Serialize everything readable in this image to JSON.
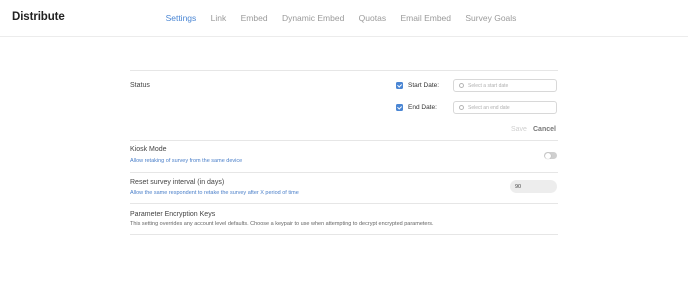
{
  "app": {
    "title": "Distribute"
  },
  "nav": {
    "tabs": [
      {
        "label": "Settings",
        "active": true
      },
      {
        "label": "Link"
      },
      {
        "label": "Embed"
      },
      {
        "label": "Dynamic Embed"
      },
      {
        "label": "Quotas"
      },
      {
        "label": "Email Embed"
      },
      {
        "label": "Survey Goals"
      }
    ]
  },
  "status": {
    "label": "Status",
    "start_date": {
      "label": "Start Date:",
      "checked": true,
      "placeholder": "Select a start date"
    },
    "end_date": {
      "label": "End Date:",
      "checked": true,
      "placeholder": "Select an end date"
    },
    "save_label": "Save",
    "cancel_label": "Cancel"
  },
  "kiosk": {
    "label": "Kiosk Mode",
    "description": "Allow retaking of survey from the same device",
    "enabled": false
  },
  "reset": {
    "label": "Reset survey interval (in days)",
    "description": "Allow the same respondent to retake the survey after X period of time",
    "value": "90"
  },
  "encryption": {
    "label": "Parameter Encryption Keys",
    "description": "This setting overrides any account level defaults. Choose a keypair to use when attempting to decrypt encrypted parameters."
  },
  "colors": {
    "accent": "#4a86d4",
    "muted_nav": "#9a9a9a",
    "toggle_off": "#cfcfcf"
  }
}
